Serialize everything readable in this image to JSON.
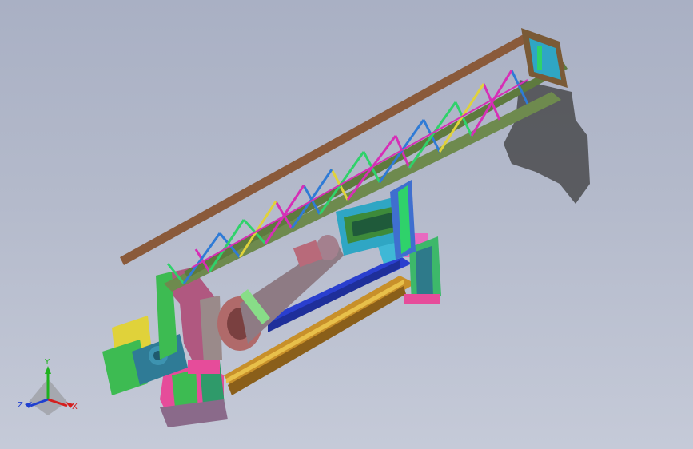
{
  "viewport": {
    "background_top": "#a9b0c4",
    "background_bottom": "#c5cad8"
  },
  "triad": {
    "y_label": "Y",
    "z_label": "Z",
    "x_label": "X",
    "y_color": "#1fb21f",
    "z_color": "#1f3fd0",
    "x_color": "#d41f1f"
  },
  "model": {
    "colors": {
      "boom_chord": "#6e8a4e",
      "boom_top": "#8a5a3a",
      "truss_a": "#2f7bd6",
      "truss_b": "#2fd26a",
      "truss_c": "#d62fb6",
      "truss_d": "#e0d23a",
      "rail_blue": "#2a3fcf",
      "rail_orange": "#c8902a",
      "column_pink": "#e64c9a",
      "column_green": "#3dbb52",
      "motor_gray": "#8e7b84",
      "frame_brown": "#7a5a36",
      "shadow": "#3a3a3a"
    }
  }
}
